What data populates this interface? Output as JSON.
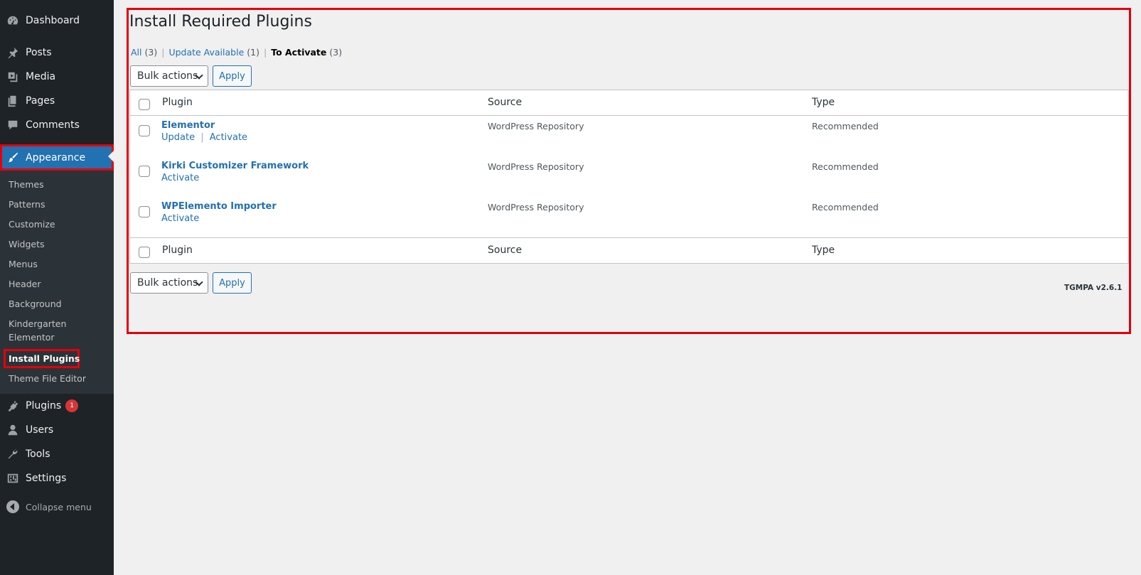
{
  "sidebar": {
    "items": [
      {
        "label": "Dashboard",
        "icon": "dashboard-icon"
      },
      {
        "label": "Posts",
        "icon": "pin-icon"
      },
      {
        "label": "Media",
        "icon": "media-icon"
      },
      {
        "label": "Pages",
        "icon": "pages-icon"
      },
      {
        "label": "Comments",
        "icon": "comment-icon"
      },
      {
        "label": "Appearance",
        "icon": "paintbrush-icon",
        "active": true
      },
      {
        "label": "Plugins",
        "icon": "plugin-icon",
        "badge": "1"
      },
      {
        "label": "Users",
        "icon": "user-icon"
      },
      {
        "label": "Tools",
        "icon": "wrench-icon"
      },
      {
        "label": "Settings",
        "icon": "settings-icon"
      }
    ],
    "submenu": [
      "Themes",
      "Patterns",
      "Customize",
      "Widgets",
      "Menus",
      "Header",
      "Background",
      "Kindergarten",
      "Elementor",
      "Install Plugins",
      "Theme File Editor"
    ],
    "collapse_label": "Collapse menu"
  },
  "page": {
    "title": "Install Required Plugins",
    "filters": [
      {
        "label": "All",
        "count": "(3)"
      },
      {
        "label": "Update Available",
        "count": "(1)"
      },
      {
        "label": "To Activate",
        "count": "(3)",
        "current": true
      }
    ],
    "bulk_label": "Bulk actions",
    "apply_label": "Apply",
    "columns": [
      "Plugin",
      "Source",
      "Type"
    ],
    "rows": [
      {
        "name": "Elementor",
        "source": "WordPress Repository",
        "type": "Recommended",
        "actions": [
          "Update",
          "Activate"
        ]
      },
      {
        "name": "Kirki Customizer Framework",
        "source": "WordPress Repository",
        "type": "Recommended",
        "actions": [
          "Activate"
        ]
      },
      {
        "name": "WPElemento Importer",
        "source": "WordPress Repository",
        "type": "Recommended",
        "actions": [
          "Activate"
        ]
      }
    ],
    "version": "TGMPA v2.6.1",
    "action_separator": "|"
  },
  "colors": {
    "accent": "#2271b1",
    "highlight": "#e3000b",
    "sidebar_bg": "#1d2327",
    "badge": "#d63638"
  }
}
